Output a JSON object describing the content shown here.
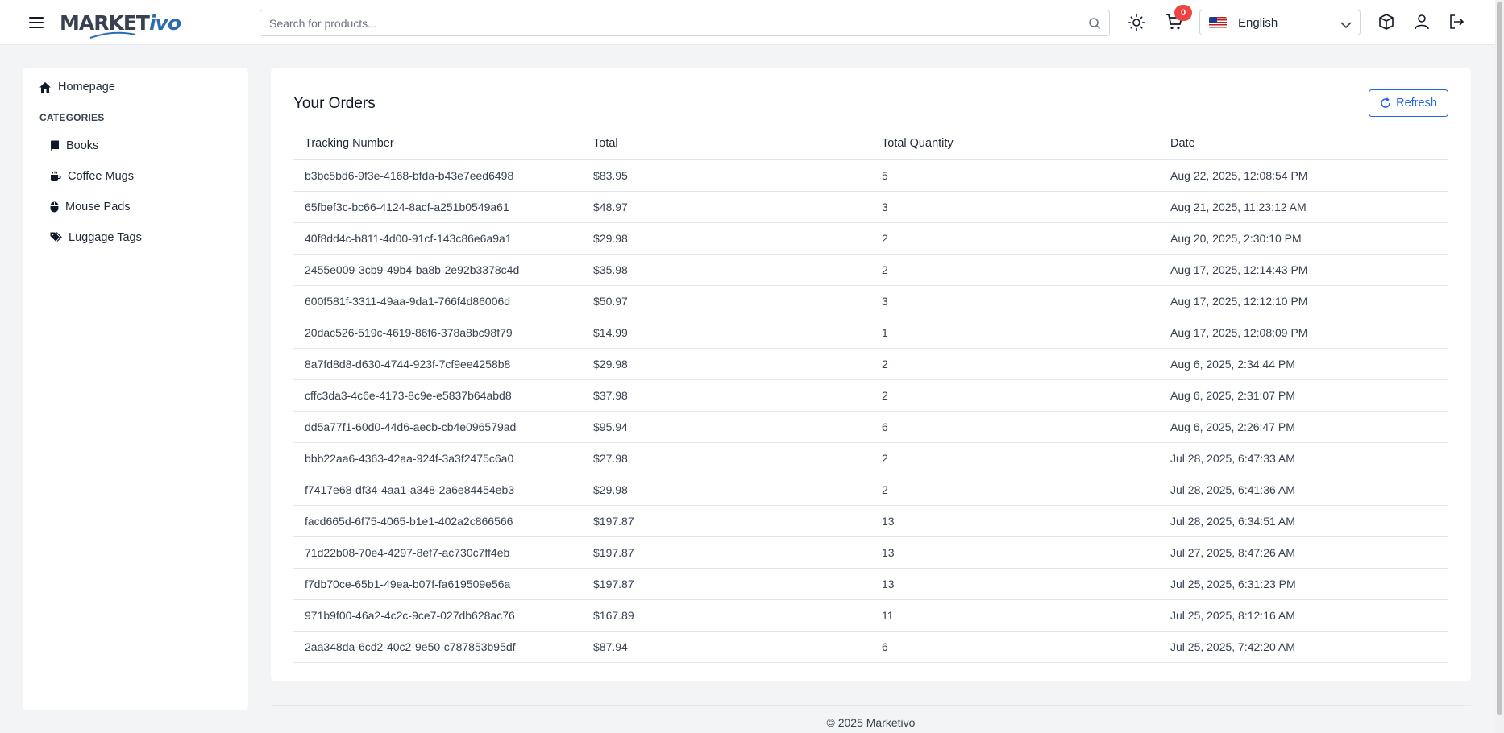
{
  "header": {
    "logo_main": "MARKET",
    "logo_accent": "ivo",
    "search_placeholder": "Search for products...",
    "cart_count": "0",
    "language": "English"
  },
  "sidebar": {
    "home_label": "Homepage",
    "categories_heading": "CATEGORIES",
    "items": [
      {
        "label": "Books",
        "icon": "book-icon"
      },
      {
        "label": "Coffee Mugs",
        "icon": "mug-icon"
      },
      {
        "label": "Mouse Pads",
        "icon": "mouse-icon"
      },
      {
        "label": "Luggage Tags",
        "icon": "tags-icon"
      }
    ]
  },
  "main": {
    "title": "Your Orders",
    "refresh_label": "Refresh",
    "columns": [
      "Tracking Number",
      "Total",
      "Total Quantity",
      "Date"
    ],
    "rows": [
      [
        "b3bc5bd6-9f3e-4168-bfda-b43e7eed6498",
        "$83.95",
        "5",
        "Aug 22, 2025, 12:08:54 PM"
      ],
      [
        "65fbef3c-bc66-4124-8acf-a251b0549a61",
        "$48.97",
        "3",
        "Aug 21, 2025, 11:23:12 AM"
      ],
      [
        "40f8dd4c-b811-4d00-91cf-143c86e6a9a1",
        "$29.98",
        "2",
        "Aug 20, 2025, 2:30:10 PM"
      ],
      [
        "2455e009-3cb9-49b4-ba8b-2e92b3378c4d",
        "$35.98",
        "2",
        "Aug 17, 2025, 12:14:43 PM"
      ],
      [
        "600f581f-3311-49aa-9da1-766f4d86006d",
        "$50.97",
        "3",
        "Aug 17, 2025, 12:12:10 PM"
      ],
      [
        "20dac526-519c-4619-86f6-378a8bc98f79",
        "$14.99",
        "1",
        "Aug 17, 2025, 12:08:09 PM"
      ],
      [
        "8a7fd8d8-d630-4744-923f-7cf9ee4258b8",
        "$29.98",
        "2",
        "Aug 6, 2025, 2:34:44 PM"
      ],
      [
        "cffc3da3-4c6e-4173-8c9e-e5837b64abd8",
        "$37.98",
        "2",
        "Aug 6, 2025, 2:31:07 PM"
      ],
      [
        "dd5a77f1-60d0-44d6-aecb-cb4e096579ad",
        "$95.94",
        "6",
        "Aug 6, 2025, 2:26:47 PM"
      ],
      [
        "bbb22aa6-4363-42aa-924f-3a3f2475c6a0",
        "$27.98",
        "2",
        "Jul 28, 2025, 6:47:33 AM"
      ],
      [
        "f7417e68-df34-4aa1-a348-2a6e84454eb3",
        "$29.98",
        "2",
        "Jul 28, 2025, 6:41:36 AM"
      ],
      [
        "facd665d-6f75-4065-b1e1-402a2c866566",
        "$197.87",
        "13",
        "Jul 28, 2025, 6:34:51 AM"
      ],
      [
        "71d22b08-70e4-4297-8ef7-ac730c7ff4eb",
        "$197.87",
        "13",
        "Jul 27, 2025, 8:47:26 AM"
      ],
      [
        "f7db70ce-65b1-49ea-b07f-fa619509e56a",
        "$197.87",
        "13",
        "Jul 25, 2025, 6:31:23 PM"
      ],
      [
        "971b9f00-46a2-4c2c-9ce7-027db628ac76",
        "$167.89",
        "11",
        "Jul 25, 2025, 8:12:16 AM"
      ],
      [
        "2aa348da-6cd2-40c2-9e50-c787853b95df",
        "$87.94",
        "6",
        "Jul 25, 2025, 7:42:20 AM"
      ]
    ]
  },
  "footer": {
    "copyright": "© 2025 Marketivo"
  },
  "colors": {
    "accent": "#2563eb",
    "badge": "#ef4444",
    "background": "#f3f4f6"
  }
}
